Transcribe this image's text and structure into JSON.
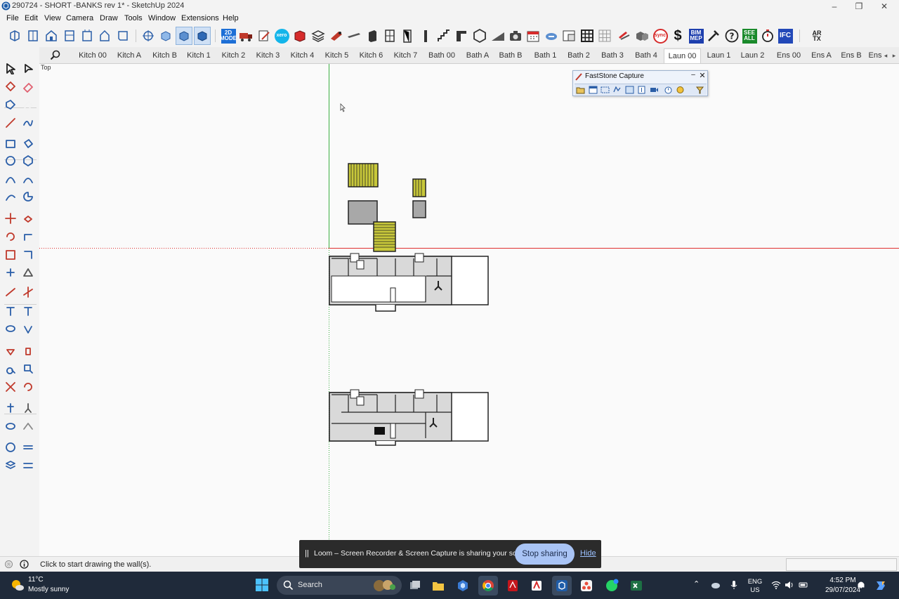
{
  "window": {
    "title": "290724 - SHORT -BANKS rev 1* - SketchUp 2024",
    "minimize": "–",
    "restore": "❐",
    "close": "✕"
  },
  "menu": [
    "File",
    "Edit",
    "View",
    "Camera",
    "Draw",
    "Tools",
    "Window",
    "Extensions",
    "Help"
  ],
  "toolbar": {
    "icons": [
      "front-view-icon",
      "side-view-icon",
      "house-front-icon",
      "right-view-icon",
      "back-view-icon",
      "left-view-icon",
      "bottom-view-icon",
      "orbit-icon",
      "hidden-line-icon",
      "shaded-icon",
      "shaded-texture-icon",
      "2d-mode-icon",
      "truck-icon",
      "paper-edit-icon",
      "xero-icon",
      "red-box-icon",
      "layers-icon",
      "saw-icon",
      "beam-icon",
      "column-icon",
      "window-icon",
      "door-icon",
      "post-icon",
      "stairs-icon",
      "bracket-icon",
      "hexagon-icon",
      "ramp-icon",
      "camera-icon",
      "calendar-icon",
      "cloud-sync-icon",
      "table-icon",
      "grid-icon",
      "grid-light-icon",
      "paint-icon",
      "boxes-icon",
      "sync-icon",
      "dollar-icon",
      "bim-mep-icon",
      "tools-icon",
      "help-icon",
      "see-all-icon",
      "timer-icon",
      "ifc-icon",
      "text-format-icon"
    ],
    "badges": {
      "mode_2d": "2D\nMODE",
      "xero": "xero",
      "sync": "sync",
      "dollar": "$",
      "bim_mep": "BIM\nMEP",
      "see_all": "SEE\nALL",
      "ifc": "IFC",
      "text_fmt": "A̲R TX"
    }
  },
  "scenes": {
    "tabs": [
      "Kitch 00",
      "Kitch A",
      "Kitch B",
      "Kitch 1",
      "Kitch 2",
      "Kitch 3",
      "Kitch 4",
      "Kitch 5",
      "Kitch 6",
      "Kitch 7",
      "Bath 00",
      "Bath A",
      "Bath B",
      "Bath 1",
      "Bath 2",
      "Bath 3",
      "Bath 4",
      "Laun 00",
      "Laun 1",
      "Laun 2",
      "Ens 00",
      "Ens A",
      "Ens B",
      "Ens"
    ],
    "active": "Laun 00",
    "prev": "◂",
    "next": "▸"
  },
  "viewport": {
    "view_name": "Top",
    "colors": {
      "red_axis": "#e03030",
      "green_axis": "#3cb043",
      "wall_fill": "#d9d9d9",
      "yellow_stair": "#c8c83a"
    }
  },
  "faststone": {
    "title": "FastStone Capture",
    "minimize": "–",
    "close": "✕"
  },
  "status": {
    "text": "Click to start drawing the wall(s)."
  },
  "loom": {
    "pause": "||",
    "message": "Loom – Screen Recorder & Screen Capture is sharing your screen.",
    "stop_label": "Stop sharing",
    "hide_label": "Hide"
  },
  "taskbar": {
    "weather_temp": "11°C",
    "weather_desc": "Mostly sunny",
    "search_placeholder": "Search",
    "lang_top": "ENG",
    "lang_bottom": "US",
    "time": "4:52 PM",
    "date": "29/07/2024",
    "apps": [
      "search-highlight-icon",
      "file-explorer-icon",
      "folder-icon",
      "copilot-icon",
      "chrome-icon",
      "acrobat-icon",
      "office-icon",
      "sketchup-icon",
      "app-dots-icon",
      "whatsapp-icon",
      "excel-icon"
    ]
  }
}
